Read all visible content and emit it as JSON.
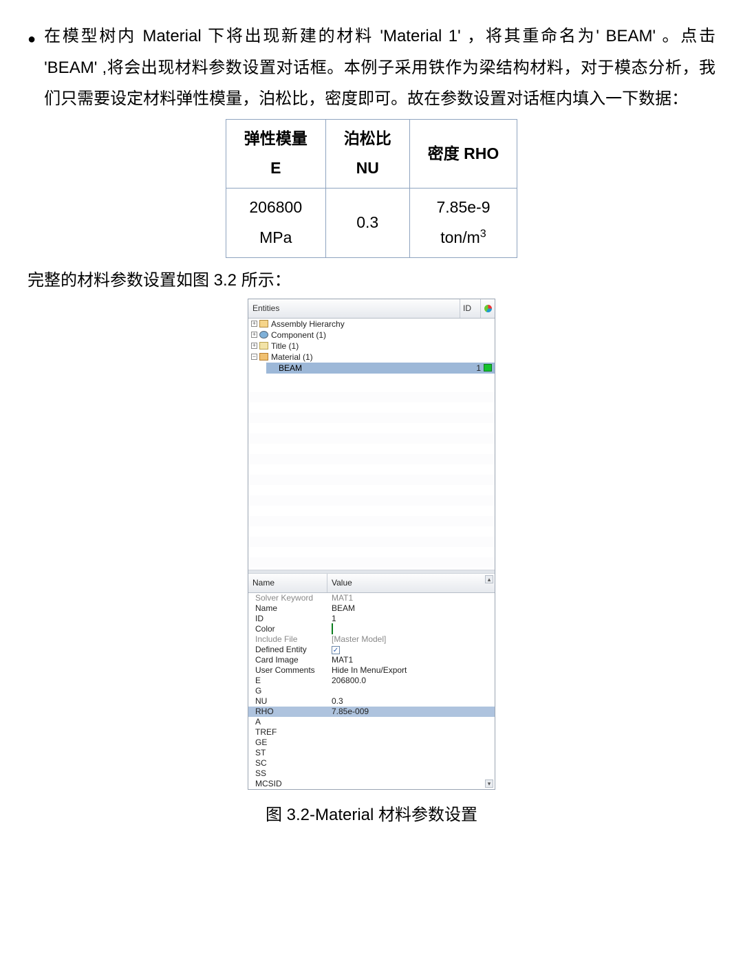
{
  "bullet": "在模型树内 Material 下将出现新建的材料 'Material 1' ，将其重命名为' BEAM' 。点击 'BEAM' ,将会出现材料参数设置对话框。本例子采用铁作为梁结构材料，对于模态分析，我们只需要设定材料弹性模量，泊松比，密度即可。故在参数设置对话框内填入一下数据：",
  "param_table": {
    "h1a": "弹性模量",
    "h1b": "E",
    "h2a": "泊松比",
    "h2b": "NU",
    "h3a": "密度 RHO",
    "h3b": "",
    "v1a": "206800",
    "v1b": "MPa",
    "v2a": "0.3",
    "v2b": "",
    "v3a": "7.85e-9",
    "v3b_prefix": "ton/m",
    "v3b_sup": "3"
  },
  "caption_line": "完整的材料参数设置如图 3.2 所示：",
  "tree": {
    "head_entities": "Entities",
    "head_id": "ID",
    "rows": [
      {
        "label": "Assembly Hierarchy"
      },
      {
        "label": "Component (1)"
      },
      {
        "label": "Title (1)"
      },
      {
        "label": "Material (1)"
      }
    ],
    "selected": {
      "label": "BEAM",
      "id": "1"
    }
  },
  "props": {
    "head_name": "Name",
    "head_value": "Value",
    "rows": [
      {
        "n": "Solver Keyword",
        "v": "MAT1",
        "gray": true
      },
      {
        "n": "Name",
        "v": "BEAM"
      },
      {
        "n": "ID",
        "v": "1"
      },
      {
        "n": "Color",
        "v": "__COLOR__"
      },
      {
        "n": "Include File",
        "v": "[Master Model]",
        "gray": true
      },
      {
        "n": "Defined Entity",
        "v": "__CHECK__"
      },
      {
        "n": "Card Image",
        "v": "MAT1"
      },
      {
        "n": "User Comments",
        "v": "Hide In Menu/Export"
      },
      {
        "n": "E",
        "v": "206800.0"
      },
      {
        "n": "G",
        "v": ""
      },
      {
        "n": "NU",
        "v": "0.3"
      },
      {
        "n": "RHO",
        "v": "7.85e-009",
        "sel": true
      },
      {
        "n": "A",
        "v": ""
      },
      {
        "n": "TREF",
        "v": ""
      },
      {
        "n": "GE",
        "v": ""
      },
      {
        "n": "ST",
        "v": ""
      },
      {
        "n": "SC",
        "v": ""
      },
      {
        "n": "SS",
        "v": ""
      },
      {
        "n": "MCSID",
        "v": ""
      }
    ]
  },
  "figure_caption": "图 3.2-Material 材料参数设置"
}
